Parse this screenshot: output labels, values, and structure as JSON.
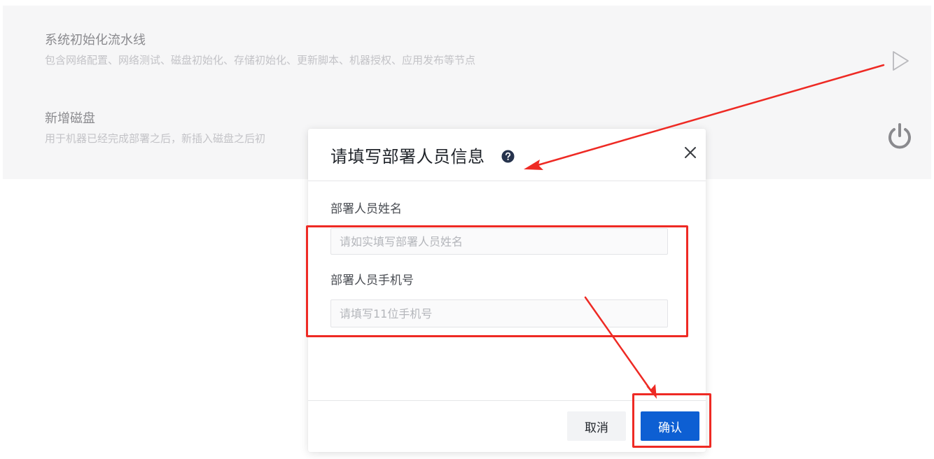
{
  "list": {
    "items": [
      {
        "title": "系统初始化流水线",
        "description": "包含网络配置、网络测试、磁盘初始化、存储初始化、更新脚本、机器授权、应用发布等节点",
        "action_icon": "play-icon"
      },
      {
        "title": "新增磁盘",
        "description": "用于机器已经完成部署之后，新插入磁盘之后初",
        "action_icon": "power-icon"
      }
    ]
  },
  "dialog": {
    "title": "请填写部署人员信息",
    "help_icon": "question-circle-icon",
    "close_icon": "close-icon",
    "fields": {
      "name": {
        "label": "部署人员姓名",
        "value": "",
        "placeholder": "请如实填写部署人员姓名"
      },
      "phone": {
        "label": "部署人员手机号",
        "value": "",
        "placeholder": "请填写11位手机号"
      }
    },
    "buttons": {
      "cancel": "取消",
      "confirm": "确认"
    }
  },
  "colors": {
    "primary": "#0d5fd3",
    "annotation": "#ee2a24",
    "panel_bg": "#f6f6f7"
  }
}
